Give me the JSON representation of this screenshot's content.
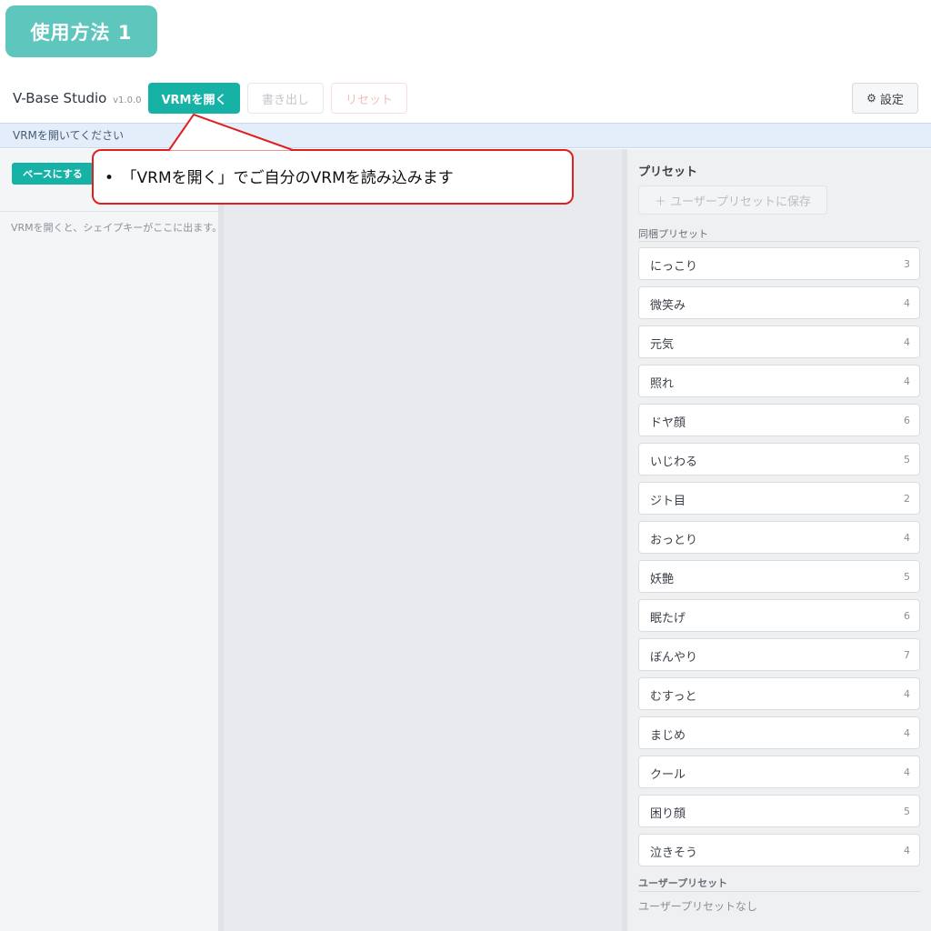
{
  "badge": {
    "label": "使用方法 1"
  },
  "toolbar": {
    "app_title": "V-Base Studio",
    "version": "v1.0.0",
    "open_label": "VRMを開く",
    "export_label": "書き出し",
    "reset_label": "リセット",
    "settings_icon": "⚙",
    "settings_label": "設定"
  },
  "status": {
    "text": "VRMを開いてください"
  },
  "left_panel": {
    "base_button": "ベースにする",
    "hint": "VRMを開くと、シェイプキーがここに出ます。"
  },
  "callout": {
    "text": "•　「VRMを開く」でご自分のVRMを読み込みます"
  },
  "right_panel": {
    "title": "プリセット",
    "save_button": "＋ ユーザープリセットに保存",
    "bundled_label": "同梱プリセット",
    "presets": [
      {
        "name": "にっこり",
        "count": "3"
      },
      {
        "name": "微笑み",
        "count": "4"
      },
      {
        "name": "元気",
        "count": "4"
      },
      {
        "name": "照れ",
        "count": "4"
      },
      {
        "name": "ドヤ顔",
        "count": "6"
      },
      {
        "name": "いじわる",
        "count": "5"
      },
      {
        "name": "ジト目",
        "count": "2"
      },
      {
        "name": "おっとり",
        "count": "4"
      },
      {
        "name": "妖艶",
        "count": "5"
      },
      {
        "name": "眠たげ",
        "count": "6"
      },
      {
        "name": "ぼんやり",
        "count": "7"
      },
      {
        "name": "むすっと",
        "count": "4"
      },
      {
        "name": "まじめ",
        "count": "4"
      },
      {
        "name": "クール",
        "count": "4"
      },
      {
        "name": "困り顔",
        "count": "5"
      },
      {
        "name": "泣きそう",
        "count": "4"
      }
    ],
    "user_label": "ユーザープリセット",
    "user_empty": "ユーザープリセットなし"
  },
  "colors": {
    "accent": "#17b2a6",
    "badge": "#5fc6bd",
    "callout_border": "#e02020"
  }
}
